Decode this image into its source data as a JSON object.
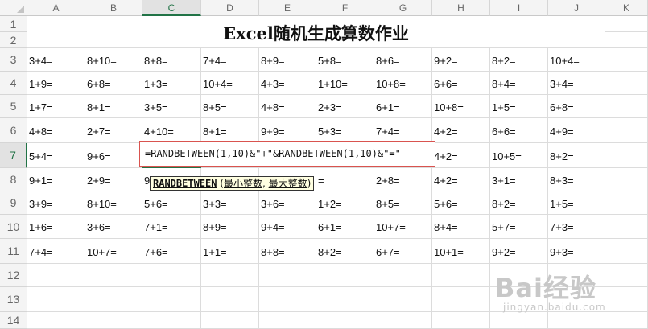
{
  "sheet": {
    "title": "Excel随机生成算数作业",
    "columns": [
      "A",
      "B",
      "C",
      "D",
      "E",
      "F",
      "G",
      "H",
      "I",
      "J",
      "K"
    ],
    "rows": [
      "1",
      "2",
      "3",
      "4",
      "5",
      "6",
      "7",
      "8",
      "9",
      "10",
      "11",
      "12",
      "13",
      "14"
    ],
    "selected_column": "C",
    "selected_row": "7",
    "data_rows": [
      [
        "3+4=",
        "8+10=",
        "8+8=",
        "7+4=",
        "8+9=",
        "5+8=",
        "8+6=",
        "9+2=",
        "8+2=",
        "10+4="
      ],
      [
        "1+9=",
        "6+8=",
        "1+3=",
        "10+4=",
        "4+3=",
        "1+10=",
        "10+8=",
        "6+6=",
        "8+4=",
        "3+4="
      ],
      [
        "1+7=",
        "8+1=",
        "3+5=",
        "8+5=",
        "4+8=",
        "2+3=",
        "6+1=",
        "10+8=",
        "1+5=",
        "6+8="
      ],
      [
        "4+8=",
        "2+7=",
        "4+10=",
        "8+1=",
        "9+9=",
        "5+3=",
        "7+4=",
        "4+2=",
        "6+6=",
        "4+9="
      ],
      [
        "5+4=",
        "9+6=",
        "",
        "",
        "",
        "",
        "",
        "4+2=",
        "10+5=",
        "8+2="
      ],
      [
        "9+1=",
        "2+9=",
        "9",
        "",
        "",
        "=",
        "2+8=",
        "4+2=",
        "3+1=",
        "8+3="
      ],
      [
        "3+9=",
        "8+10=",
        "5+6=",
        "3+3=",
        "3+6=",
        "1+2=",
        "8+5=",
        "5+6=",
        "8+2=",
        "1+5="
      ],
      [
        "1+6=",
        "3+6=",
        "7+1=",
        "8+9=",
        "9+4=",
        "6+1=",
        "10+7=",
        "8+4=",
        "5+7=",
        "7+3="
      ],
      [
        "7+4=",
        "10+7=",
        "7+6=",
        "1+1=",
        "8+8=",
        "8+2=",
        "6+7=",
        "10+1=",
        "9+2=",
        "9+3="
      ]
    ]
  },
  "formula": {
    "text": "=RANDBETWEEN(1,10)&\"+\"&RANDBETWEEN(1,10)&\"=\""
  },
  "tooltip": {
    "function": "RANDBETWEEN",
    "open": " (",
    "arg1": "最小整数",
    "sep": ", ",
    "arg2": "最大整数",
    "close": ")"
  },
  "watermark": {
    "brand": "Bai经验",
    "url": "jingyan.baidu.com"
  }
}
